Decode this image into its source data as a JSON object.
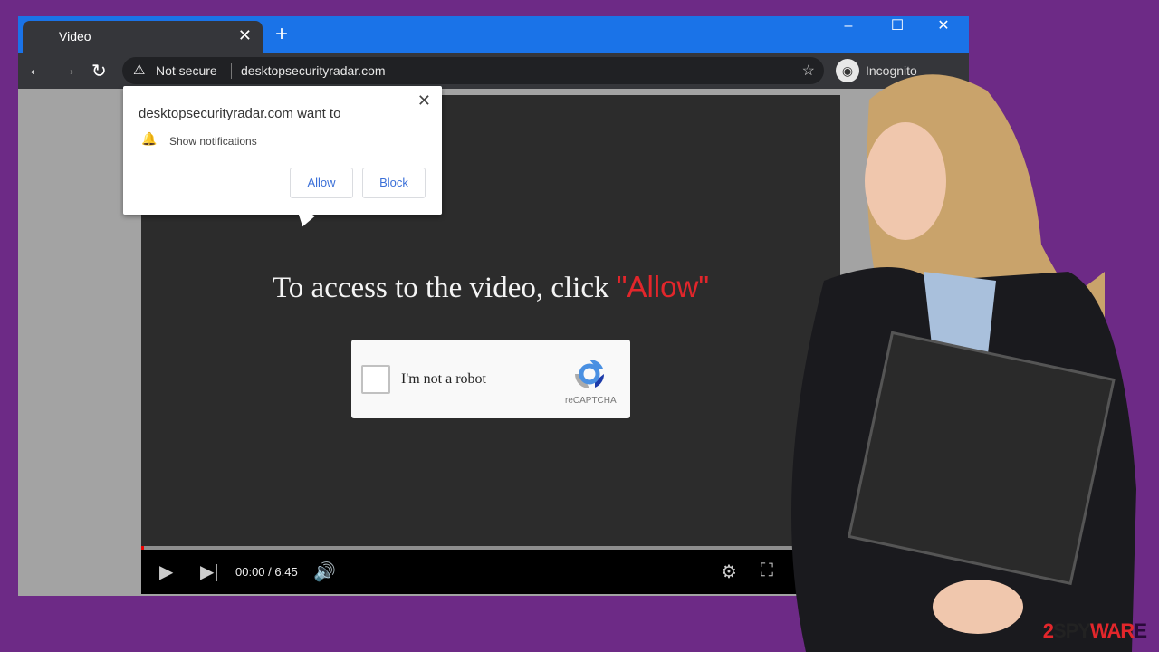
{
  "browser": {
    "tab_title": "Video",
    "new_tab": "+",
    "close_tab": "✕",
    "window": {
      "minimize": "–",
      "maximize": "☐",
      "close": "✕"
    },
    "security": "Not secure",
    "url": "desktopsecurityradar.com",
    "profile": "Incognito"
  },
  "popup": {
    "title": "desktopsecurityradar.com want to",
    "permission": "Show notifications",
    "allow": "Allow",
    "block": "Block",
    "close": "✕"
  },
  "page": {
    "headline_prefix": "To access to the video, click ",
    "headline_allow": "\"Allow\"",
    "captcha": {
      "label": "I'm not a robot",
      "brand": "reCAPTCHA",
      "checked": false
    }
  },
  "player": {
    "time": "00:00 / 6:45",
    "progress": 0
  },
  "watermark": {
    "text": "2SPYWARE"
  },
  "colors": {
    "background": "#6d2a86",
    "tabbar": "#1a73e8",
    "toolbar": "#35363a",
    "accent_red": "#e2262b"
  }
}
